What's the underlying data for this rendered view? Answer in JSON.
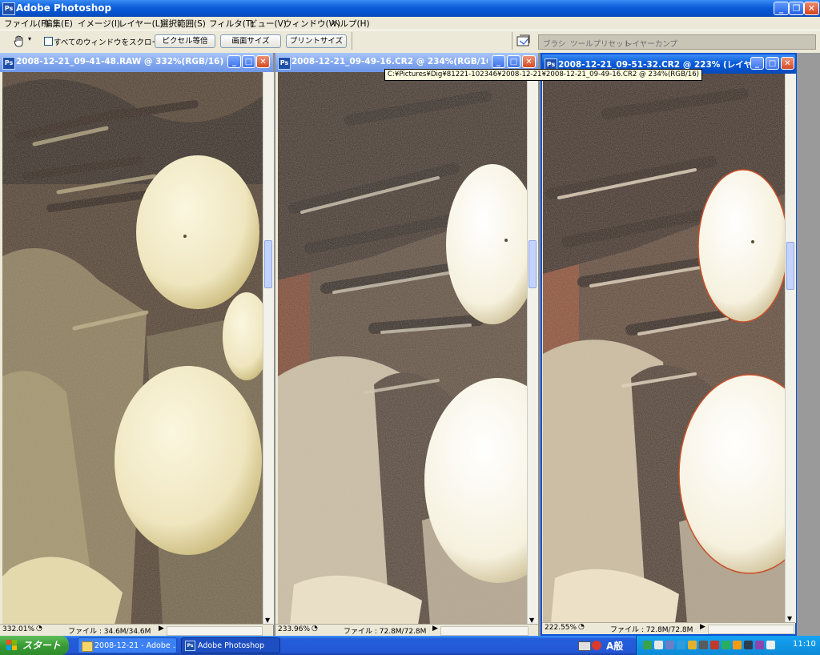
{
  "app": {
    "title": "Adobe Photoshop"
  },
  "menu": [
    "ファイル(F)",
    "編集(E)",
    "イメージ(I)",
    "レイヤー(L)",
    "選択範囲(S)",
    "フィルタ(T)",
    "ビュー(V)",
    "ウィンドウ(W)",
    "ヘルプ(H)"
  ],
  "options": {
    "scroll_all_label": "すべてのウィンドウをスクロール",
    "actual_pixels": "ピクセル等倍",
    "fit_screen": "画面サイズ",
    "print_size": "プリントサイズ",
    "well_tabs": [
      "ブラシ",
      "ツールプリセット",
      "レイヤーカンプ"
    ]
  },
  "windows": [
    {
      "title": "2008-12-21_09-41-48.RAW @ 332%(RGB/16)",
      "zoom": "332.01%",
      "file_info": "ファイル : 34.6M/34.6M",
      "active": false
    },
    {
      "title": "2008-12-21_09-49-16.CR2 @ 234%(RGB/16)",
      "zoom": "233.96%",
      "file_info": "ファイル : 72.8M/72.8M",
      "active": false
    },
    {
      "title": "2008-12-21_09-51-32.CR2 @ 223% (レイヤ...",
      "zoom": "222.55%",
      "file_info": "ファイル : 72.8M/72.8M",
      "active": true
    }
  ],
  "tooltip": "C:¥Pictures¥Dig¥81221-102346¥2008-12-21¥2008-12-21_09-49-16.CR2 @ 234%(RGB/16)",
  "taskbar": {
    "start": "スタート",
    "items": [
      "2008-12-21 - Adobe ...",
      "Adobe Photoshop"
    ],
    "ime": "A般",
    "clock": "11:10"
  },
  "colors": {
    "xp_blue": "#0a5bd8",
    "xp_green": "#3a9c36",
    "tooltip_bg": "#ffffe1"
  }
}
